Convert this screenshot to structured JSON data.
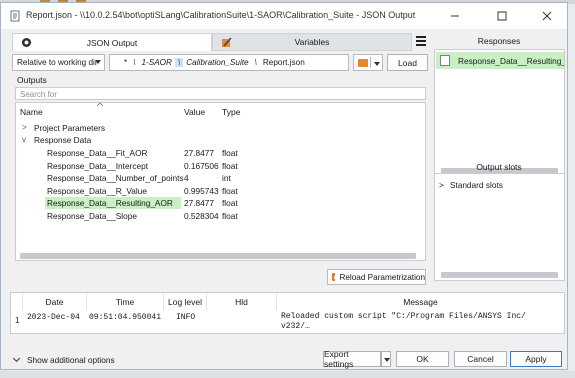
{
  "window": {
    "title": "Report.json - \\\\10.0.2.54\\bot\\optiSLang\\CalibrationSuite\\1-SAOR\\Calibration_Suite - JSON Output"
  },
  "tabs": [
    {
      "label": "JSON Output",
      "active": true
    },
    {
      "label": "Variables",
      "active": false
    }
  ],
  "path_bar": {
    "mode_select": "Relative to working dir",
    "segments": [
      "*",
      "1-SAOR",
      "Calibration_Suite",
      "Report.json"
    ],
    "load_label": "Load"
  },
  "outputs": {
    "label": "Outputs",
    "search_placeholder": "Search for",
    "columns": [
      "Name",
      "Value",
      "Type"
    ],
    "tree": [
      {
        "name": "Project Parameters",
        "level": 0,
        "expander": ">",
        "value": "",
        "type": ""
      },
      {
        "name": "Response Data",
        "level": 0,
        "expander": "v",
        "value": "",
        "type": ""
      },
      {
        "name": "Response_Data__Fit_AOR",
        "level": 1,
        "value": "27.8477",
        "type": "float"
      },
      {
        "name": "Response_Data__Intercept",
        "level": 1,
        "value": "0.167506",
        "type": "float"
      },
      {
        "name": "Response_Data__Number_of_points",
        "level": 1,
        "value": "4",
        "type": "int"
      },
      {
        "name": "Response_Data__R_Value",
        "level": 1,
        "value": "0.995743",
        "type": "float"
      },
      {
        "name": "Response_Data__Resulting_AOR",
        "level": 1,
        "value": "27.8477",
        "type": "float",
        "highlighted": true
      },
      {
        "name": "Response_Data__Slope",
        "level": 1,
        "value": "0.528304",
        "type": "float"
      }
    ],
    "reload_label": "Reload Parametrization"
  },
  "responses": {
    "title": "Responses",
    "items": [
      "Response_Data__Resulting_A"
    ]
  },
  "output_slots": {
    "title": "Output slots",
    "items": [
      "Standard slots"
    ]
  },
  "log": {
    "columns": [
      "Date",
      "Time",
      "Log level",
      "Hld",
      "Message"
    ],
    "rows": [
      {
        "index": "1",
        "date": "2023-Dec-04",
        "time": "09:51:04.950041",
        "level": "INFO",
        "hld": "",
        "message_line1": "Reloaded custom script \"C:/Program Files/ANSYS Inc/",
        "message_line2": "v232/…"
      }
    ]
  },
  "footer": {
    "show_options": "Show additional options",
    "export_label": "Export settings",
    "ok_label": "OK",
    "cancel_label": "Cancel",
    "apply_label": "Apply"
  },
  "colors": {
    "highlight_green": "#c9f0c4",
    "path_highlight": "#cfe2f6",
    "primary_border": "#3a78c9",
    "folder_orange": "#e08a2b"
  }
}
